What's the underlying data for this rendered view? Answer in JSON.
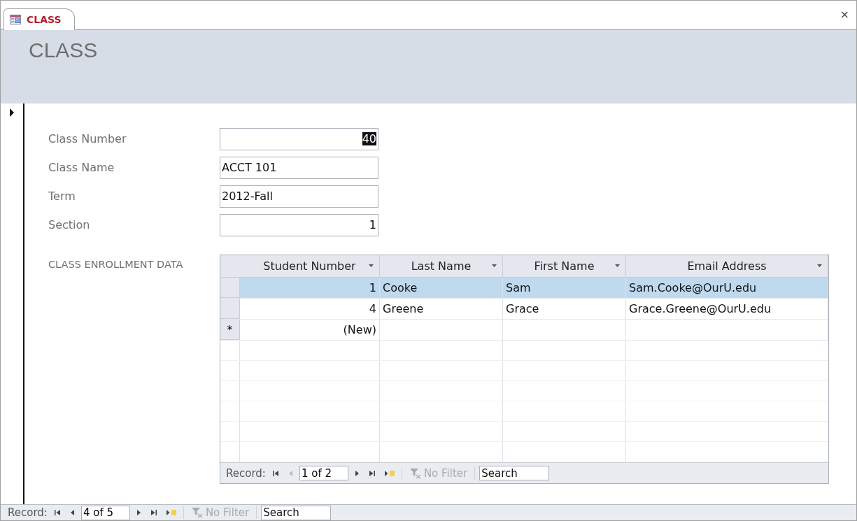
{
  "tab": {
    "title": "CLASS",
    "selected": true
  },
  "close": "×",
  "form_title": "CLASS",
  "fields": [
    {
      "label": "Class Number",
      "value": "40",
      "kind": "number",
      "highlighted": true
    },
    {
      "label": "Class Name",
      "value": "ACCT 101",
      "kind": "text",
      "highlighted": false
    },
    {
      "label": "Term",
      "value": "2012-Fall",
      "kind": "text",
      "highlighted": false
    },
    {
      "label": "Section",
      "value": "1",
      "kind": "number",
      "highlighted": false
    }
  ],
  "subform": {
    "label": "CLASS ENROLLMENT  DATA",
    "columns": [
      {
        "label": "Student Number",
        "kind": "number"
      },
      {
        "label": "Last Name",
        "kind": "text"
      },
      {
        "label": "First Name",
        "kind": "text"
      },
      {
        "label": "Email Address",
        "kind": "text"
      }
    ],
    "rows": [
      {
        "cells": [
          "1",
          "Cooke",
          "Sam",
          "Sam.Cooke@OurU.edu"
        ],
        "selected": true
      },
      {
        "cells": [
          "4",
          "Greene",
          "Grace",
          "Grace.Greene@OurU.edu"
        ],
        "selected": false
      }
    ],
    "new_row": {
      "marker": "*",
      "cells": [
        "(New)"
      ]
    },
    "navigator": {
      "label": "Record:",
      "position": "1 of 2",
      "filter": "No Filter",
      "search_placeholder": "Search",
      "prev_disabled": true
    }
  },
  "navigator": {
    "label": "Record:",
    "position": "4 of 5",
    "filter": "No Filter",
    "search_placeholder": "Search",
    "prev_disabled": false
  }
}
